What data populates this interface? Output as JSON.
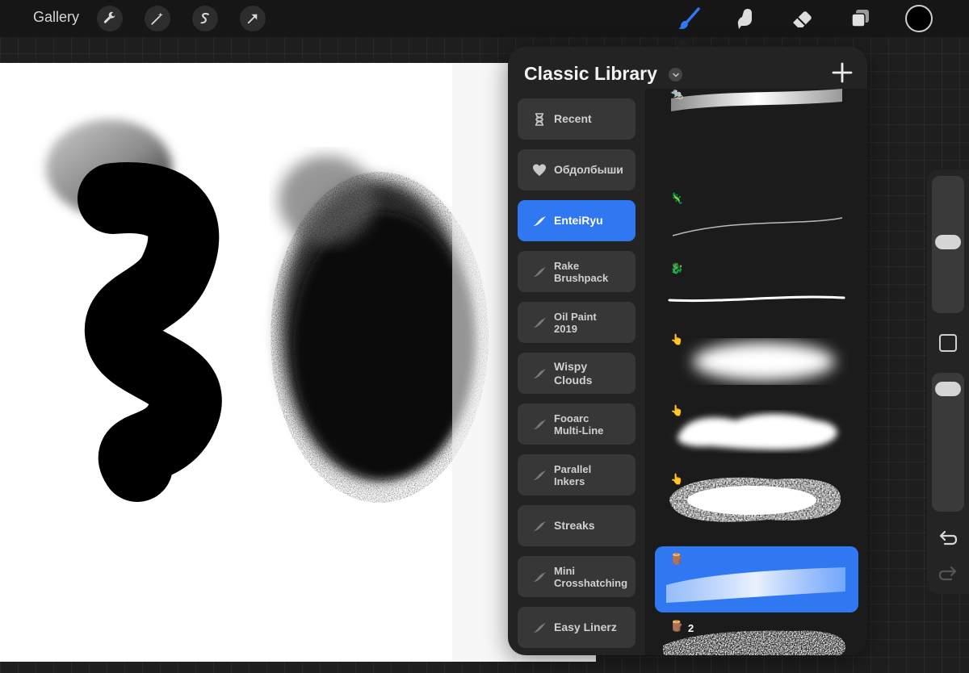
{
  "toolbar": {
    "gallery_label": "Gallery",
    "left_tools": [
      "wrench-icon",
      "magic-wand-icon",
      "selection-s-icon",
      "transform-arrow-icon"
    ],
    "right_tools": [
      "brush-icon",
      "smudge-icon",
      "eraser-icon",
      "layers-icon"
    ],
    "active_tool": "brush-icon",
    "accent_color": "#2f78f1",
    "current_color": "#000000"
  },
  "library": {
    "title": "Classic Library",
    "sets": [
      {
        "label": "Recent",
        "icon": "hourglass-icon"
      },
      {
        "label": "Обдолбыши",
        "icon": "heart-icon"
      },
      {
        "label": "EnteiRyu",
        "icon": "brush-set-icon",
        "active": true
      },
      {
        "label": "Rake\nBrushpack",
        "icon": "brush-set-icon"
      },
      {
        "label": "Oil Paint\n2019",
        "icon": "brush-set-icon"
      },
      {
        "label": "Wispy\nClouds",
        "icon": "brush-set-icon"
      },
      {
        "label": "Fooarc\nMulti-Line",
        "icon": "brush-set-icon"
      },
      {
        "label": "Parallel\nInkers",
        "icon": "brush-set-icon"
      },
      {
        "label": "Streaks",
        "icon": "brush-set-icon"
      },
      {
        "label": "Mini\nCrosshatching",
        "icon": "brush-set-icon"
      },
      {
        "label": "Easy Linerz",
        "icon": "brush-set-icon"
      }
    ],
    "brushes": [
      {
        "stroke": "gradient-band",
        "badge": "rat-emoji-icon"
      },
      {
        "stroke": "thin-line",
        "badge": "lizard-emoji-icon"
      },
      {
        "stroke": "medium-line",
        "badge": "dragon-emoji-icon"
      },
      {
        "stroke": "soft-airbrush",
        "badge": "pointing-hand-emoji-icon"
      },
      {
        "stroke": "cloud-blob",
        "badge": "pointing-hand-emoji-icon"
      },
      {
        "stroke": "rough-spray",
        "badge": "pointing-hand-emoji-icon"
      },
      {
        "stroke": "textured-paint",
        "badge": "wood-emoji-icon",
        "selected": true
      },
      {
        "stroke": "speckled-rough",
        "badge": "wood-emoji-icon",
        "number": "2"
      }
    ]
  },
  "sidebar": {
    "brush_size": 0.52,
    "opacity": 0.93
  }
}
